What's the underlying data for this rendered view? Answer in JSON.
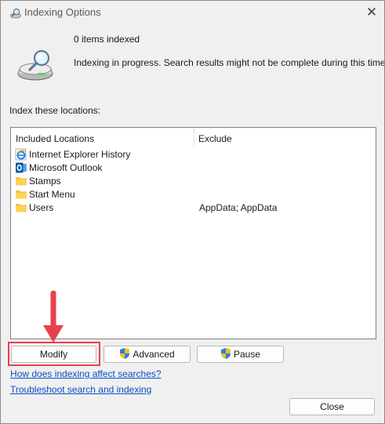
{
  "window": {
    "title": "Indexing Options",
    "close_glyph": "✕"
  },
  "status": {
    "count": "0 items indexed",
    "message": "Indexing in progress. Search results might not be complete during this time."
  },
  "section_label": "Index these locations:",
  "locations": {
    "headers": {
      "included": "Included Locations",
      "exclude": "Exclude"
    },
    "rows": [
      {
        "name": "Internet Explorer History",
        "exclude": "",
        "icon": "internet-explorer-icon"
      },
      {
        "name": "Microsoft Outlook",
        "exclude": "",
        "icon": "outlook-icon"
      },
      {
        "name": "Stamps",
        "exclude": "",
        "icon": "folder-icon"
      },
      {
        "name": "Start Menu",
        "exclude": "",
        "icon": "folder-icon"
      },
      {
        "name": "Users",
        "exclude": "AppData; AppData",
        "icon": "folder-icon"
      }
    ]
  },
  "buttons": {
    "modify": "Modify",
    "advanced": "Advanced",
    "pause": "Pause",
    "close": "Close"
  },
  "links": {
    "how_affects": "How does indexing affect searches?",
    "troubleshoot": "Troubleshoot search and indexing"
  },
  "annotation": {
    "color": "#e8414e"
  }
}
